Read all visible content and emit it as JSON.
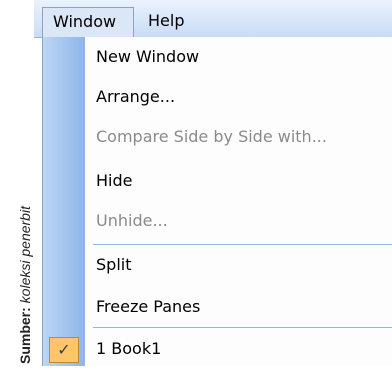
{
  "caption": {
    "prefix": "Sumber:",
    "source": "koleksi penerbit"
  },
  "menubar": {
    "window_label": "Window",
    "help_label": "Help"
  },
  "menu": {
    "items": [
      {
        "label": "New Window",
        "enabled": true
      },
      {
        "label": "Arrange...",
        "enabled": true
      },
      {
        "label": "Compare Side by Side with...",
        "enabled": false
      },
      {
        "label": "Hide",
        "enabled": true
      },
      {
        "label": "Unhide...",
        "enabled": false
      },
      {
        "label": "Split",
        "enabled": true
      },
      {
        "label": "Freeze Panes",
        "enabled": true
      },
      {
        "label": "1 Book1",
        "enabled": true,
        "checked": true
      }
    ]
  },
  "colors": {
    "menubar_bg": "#c9dcf6",
    "gutter": "#8fb5e8",
    "check_bg": "#ffc56b",
    "disabled_text": "#8a8a8a"
  }
}
